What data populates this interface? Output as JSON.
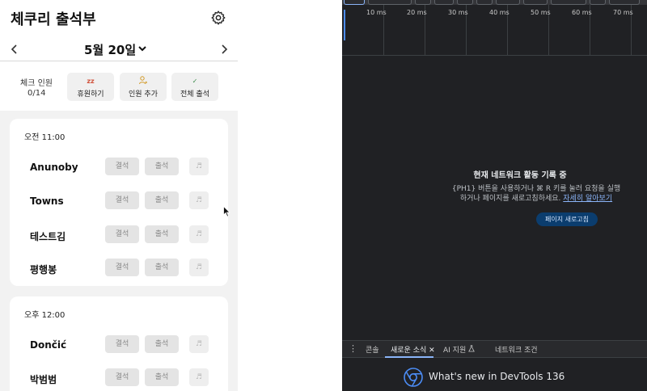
{
  "app": {
    "title": "체쿠리 출석부",
    "date": "5월 20일",
    "check_label": "체크 인원",
    "check_count": "0/14",
    "actions": [
      {
        "label": "휴원하기",
        "icon": "zz-sleep-icon",
        "glyph": "zz"
      },
      {
        "label": "인원 추가",
        "icon": "add-person-icon",
        "glyph": "👤"
      },
      {
        "label": "전체 출석",
        "icon": "check-icon",
        "glyph": "✓"
      }
    ],
    "absent_label": "결석",
    "present_label": "출석",
    "slots": [
      {
        "time": "오전 11:00",
        "students": [
          "Anunoby",
          "Towns",
          "테스트김",
          "평행봉"
        ]
      },
      {
        "time": "오후 12:00",
        "students": [
          "Dončić",
          "박범범"
        ]
      }
    ]
  },
  "devtools": {
    "ticks": [
      "10 ms",
      "20 ms",
      "30 ms",
      "40 ms",
      "50 ms",
      "60 ms",
      "70 ms"
    ],
    "empty_title": "현재 네트워크 활동 기록 중",
    "empty_desc_line1": "{PH1} 버튼을 사용하거나 ⌘ R 키를 눌러 요청을 실행",
    "empty_desc_line2": "하거나 페이지를 새로고침하세요.",
    "learn_more": "자세히 알아보기",
    "reload_button": "페이지 새로고침",
    "drawer_tabs": {
      "console": "콘솔",
      "whats_new": "새로운 소식",
      "ai": "AI 지원",
      "network_conditions": "네트워크 조건"
    },
    "whats_new_text": "What's new in DevTools 136",
    "colors": {
      "accent": "#8ab4f8",
      "background": "#202124",
      "button": "#0b3d6e"
    }
  }
}
